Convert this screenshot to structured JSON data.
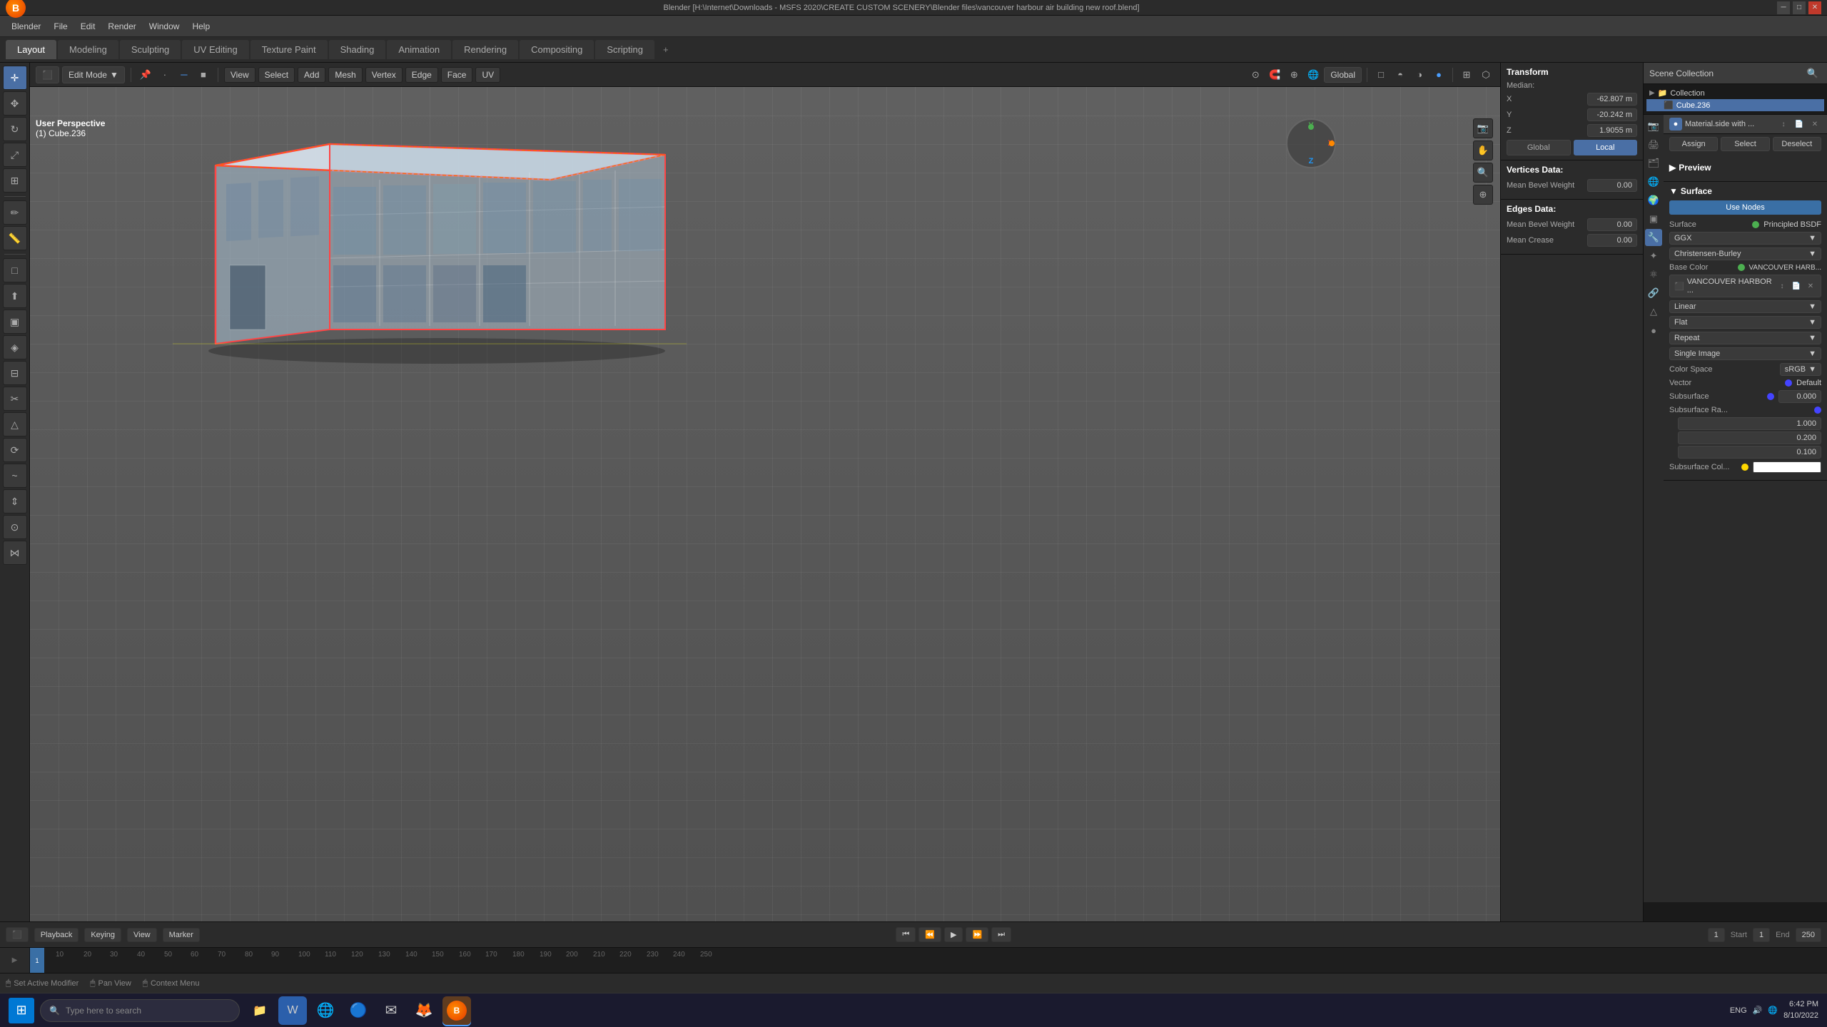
{
  "titlebar": {
    "title": "Blender [H:\\Internet\\Downloads - MSFS 2020\\CREATE CUSTOM SCENERY\\Blender files\\vancouver harbour air building new roof.blend]",
    "controls": [
      "─",
      "□",
      "✕"
    ]
  },
  "menubar": {
    "items": [
      "Blender",
      "File",
      "Edit",
      "Render",
      "Window",
      "Help"
    ]
  },
  "tabs": {
    "items": [
      "Layout",
      "Modeling",
      "Sculpting",
      "UV Editing",
      "Texture Paint",
      "Shading",
      "Animation",
      "Rendering",
      "Compositing",
      "Scripting"
    ],
    "active": "Layout",
    "plus": "+"
  },
  "viewport": {
    "mode": "Edit Mode",
    "view_label": "User Perspective",
    "object_label": "(1) Cube.236",
    "nav": [
      "View",
      "Select",
      "Add",
      "Mesh",
      "Vertex",
      "Edge",
      "Face",
      "UV"
    ],
    "global_local": [
      "Global",
      "Local"
    ],
    "active_local": "Local",
    "overlay_buttons": [
      "shading",
      "overlay",
      "xray"
    ],
    "gizmo": {
      "x": "X",
      "y": "Y",
      "z": "Z"
    },
    "transform_orientations": "Global"
  },
  "properties": {
    "transform_header": "Transform",
    "median_label": "Median:",
    "x_label": "X",
    "x_value": "-62.807 m",
    "y_label": "Y",
    "y_value": "-20.242 m",
    "z_label": "Z",
    "z_value": "1.9055 m",
    "global_btn": "Global",
    "local_btn": "Local",
    "vertices_data_header": "Vertices Data:",
    "mean_bevel_weight_verts_label": "Mean Bevel Weight",
    "mean_bevel_weight_verts_value": "0.00",
    "edges_data_header": "Edges Data:",
    "mean_bevel_weight_edges_label": "Mean Bevel Weight",
    "mean_bevel_weight_edges_value": "0.00",
    "mean_crease_label": "Mean Crease",
    "mean_crease_value": "0.00"
  },
  "scene_collection": {
    "header": "Scene Collection",
    "collection_label": "Collection",
    "cube_label": "Cube.236"
  },
  "material_panel": {
    "material_name": "Material.side with ...",
    "assign_btn": "Assign",
    "select_btn": "Select",
    "deselect_btn": "Deselect",
    "preview_header": "Preview",
    "surface_header": "Surface",
    "use_nodes_btn": "Use Nodes",
    "surface_label": "Surface",
    "surface_value": "Principled BSDF",
    "ggx_label": "GGX",
    "christensen_label": "Christensen-Burley",
    "base_color_label": "Base Color",
    "base_color_value": "VANCOUVER HARB...",
    "vancouver_texture": "VANCOUVER HARBOR ...",
    "linear_label": "Linear",
    "flat_label": "Flat",
    "repeat_label": "Repeat",
    "single_image_label": "Single Image",
    "color_space_label": "Color Space",
    "color_space_value": "sRGB",
    "vector_label": "Vector",
    "vector_value": "Default",
    "subsurface_label": "Subsurface",
    "subsurface_value": "0.000",
    "subsurface_ra_label": "Subsurface Ra...",
    "subsurface_r1": "1.000",
    "subsurface_r2": "0.200",
    "subsurface_r3": "0.100",
    "subsurface_col_label": "Subsurface Col..."
  },
  "timeline": {
    "playback_label": "Playback",
    "keying_label": "Keying",
    "view_label": "View",
    "marker_label": "Marker",
    "start_label": "Start",
    "start_value": "1",
    "end_label": "End",
    "end_value": "250",
    "current_frame": "1",
    "frame_marks": [
      "1",
      "10",
      "20",
      "30",
      "40",
      "50",
      "60",
      "70",
      "80",
      "90",
      "100",
      "110",
      "120",
      "130",
      "140",
      "150",
      "160",
      "170",
      "180",
      "190",
      "200",
      "210",
      "220",
      "230",
      "240",
      "250"
    ]
  },
  "statusbar": {
    "item1": "Set Active Modifier",
    "item2": "Pan View",
    "item3": "Context Menu"
  },
  "taskbar": {
    "search_placeholder": "Type here to search",
    "apps": [
      "⊞",
      "🔍",
      "📝",
      "📁",
      "🌐",
      "💬",
      "🦊",
      "🎮"
    ],
    "time": "6:42 PM",
    "date": "8/10/2022",
    "lang": "ENG"
  }
}
